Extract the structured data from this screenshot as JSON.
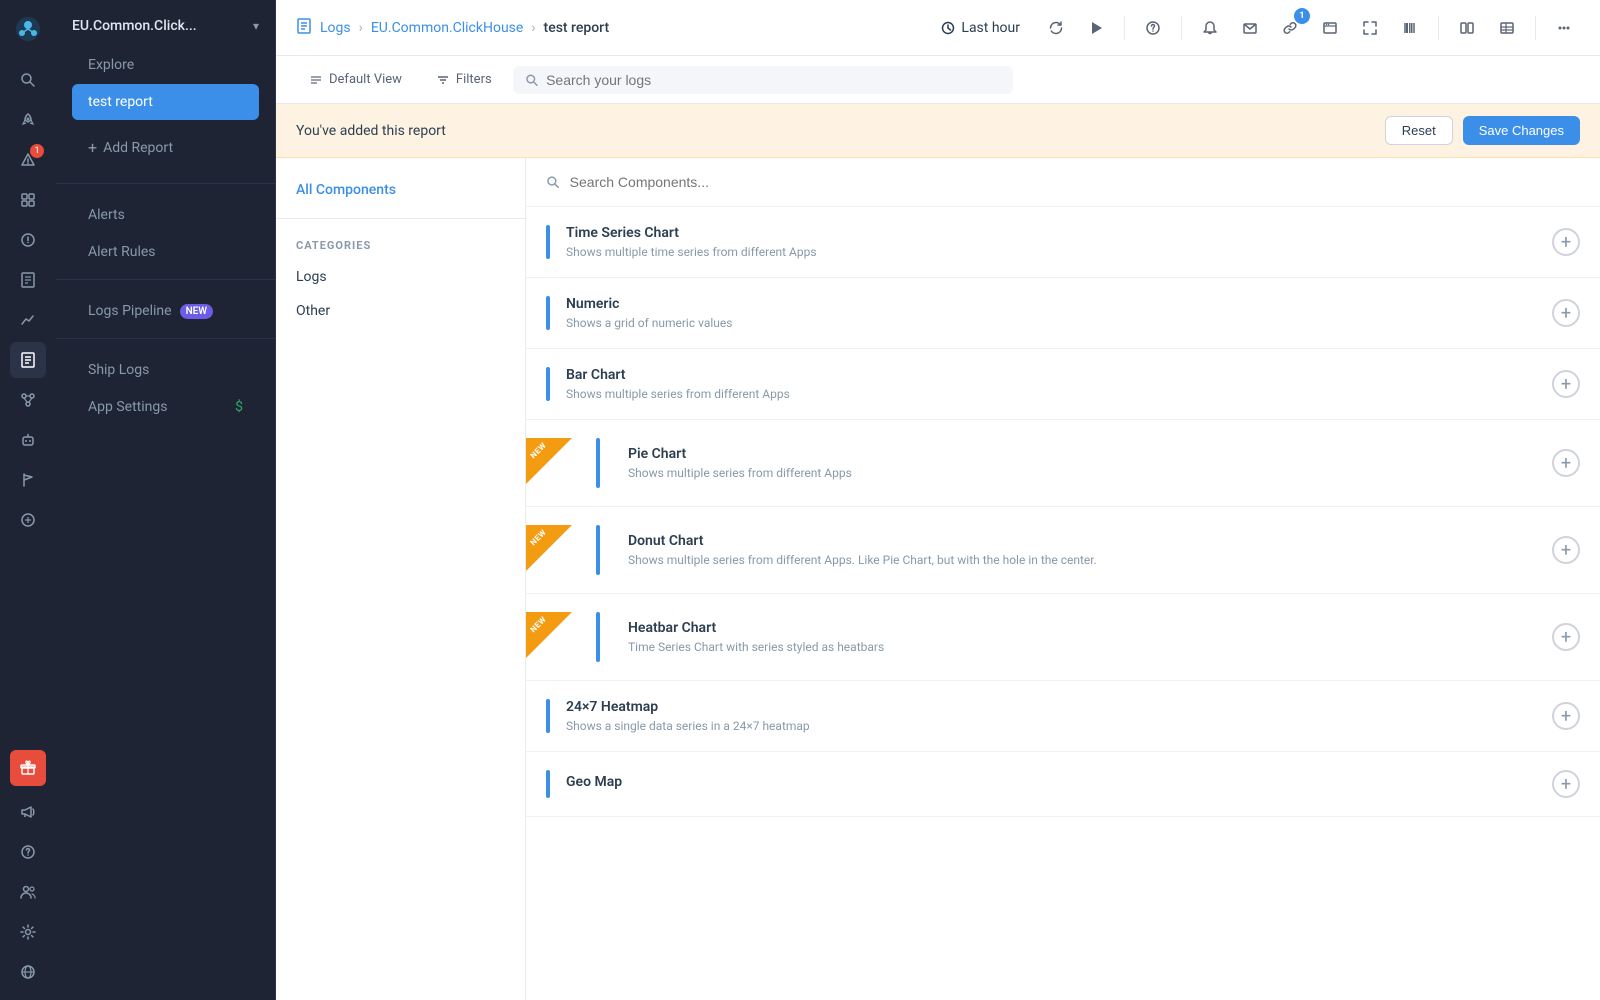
{
  "app": {
    "name": "EU.Common.Click...",
    "chevron": "▾"
  },
  "icon_sidebar": {
    "logo": "🐙",
    "icons": [
      {
        "name": "search-icon",
        "symbol": "🔍",
        "interactable": true
      },
      {
        "name": "rocket-icon",
        "symbol": "🚀",
        "interactable": true,
        "badge": null
      },
      {
        "name": "alert-icon",
        "symbol": "⚠",
        "interactable": true,
        "badge": "1"
      },
      {
        "name": "grid-icon",
        "symbol": "⊞",
        "interactable": true
      },
      {
        "name": "exclamation-icon",
        "symbol": "!",
        "interactable": true
      },
      {
        "name": "table-icon",
        "symbol": "▦",
        "interactable": true
      },
      {
        "name": "chart-icon",
        "symbol": "📊",
        "interactable": true
      },
      {
        "name": "logs-icon",
        "symbol": "📋",
        "interactable": true,
        "active": true
      },
      {
        "name": "integrations-icon",
        "symbol": "⚙",
        "interactable": true
      },
      {
        "name": "robot-icon",
        "symbol": "🤖",
        "interactable": true
      },
      {
        "name": "flag-icon",
        "symbol": "⚑",
        "interactable": true
      },
      {
        "name": "globe-icon",
        "symbol": "🌐",
        "interactable": true
      }
    ],
    "bottom_icons": [
      {
        "name": "gift-icon",
        "symbol": "🎁",
        "interactable": true
      },
      {
        "name": "megaphone-icon",
        "symbol": "📣",
        "interactable": true
      },
      {
        "name": "help-icon",
        "symbol": "?",
        "interactable": true
      },
      {
        "name": "team-icon",
        "symbol": "👥",
        "interactable": true
      },
      {
        "name": "settings-icon",
        "symbol": "⚙",
        "interactable": true
      },
      {
        "name": "language-icon",
        "symbol": "🌐",
        "interactable": true
      }
    ]
  },
  "left_panel": {
    "explore_label": "Explore",
    "active_report": "test report",
    "add_report_label": "+ Add Report",
    "sections": [
      {
        "items": [
          {
            "label": "Alerts",
            "name": "alerts-nav"
          },
          {
            "label": "Alert Rules",
            "name": "alert-rules-nav"
          }
        ]
      },
      {
        "items": [
          {
            "label": "Logs Pipeline",
            "name": "logs-pipeline-nav",
            "badge": "NEW"
          }
        ]
      },
      {
        "items": [
          {
            "label": "Ship Logs",
            "name": "ship-logs-nav"
          },
          {
            "label": "App Settings",
            "name": "app-settings-nav",
            "badge": "$"
          }
        ]
      }
    ]
  },
  "top_bar": {
    "breadcrumb": {
      "icon": "📋",
      "logs_link": "Logs",
      "app_link": "EU.Common.ClickHouse",
      "current": "test report"
    },
    "time_selector": {
      "label": "Last hour",
      "icon": "🕐"
    },
    "actions": [
      {
        "name": "refresh-icon",
        "symbol": "↻"
      },
      {
        "name": "play-icon",
        "symbol": "▶"
      },
      {
        "name": "help-icon",
        "symbol": "?"
      },
      {
        "name": "bell-icon",
        "symbol": "🔔"
      },
      {
        "name": "mail-icon",
        "symbol": "✉"
      },
      {
        "name": "link-icon",
        "symbol": "🔗",
        "badge": "1"
      },
      {
        "name": "screen-icon",
        "symbol": "⊡"
      },
      {
        "name": "fullscreen-icon",
        "symbol": "⛶"
      },
      {
        "name": "barcode-icon",
        "symbol": "▦"
      },
      {
        "name": "split-icon",
        "symbol": "⊟"
      },
      {
        "name": "table2-icon",
        "symbol": "▤"
      },
      {
        "name": "more-icon",
        "symbol": "•••"
      }
    ]
  },
  "toolbar": {
    "default_view_label": "Default View",
    "filters_label": "Filters",
    "search_placeholder": "Search your logs"
  },
  "notification_bar": {
    "text": "You've added this report",
    "reset_label": "Reset",
    "save_label": "Save Changes"
  },
  "component_panel": {
    "all_components_label": "All Components",
    "search_placeholder": "Search Components...",
    "categories_label": "CATEGORIES",
    "categories": [
      {
        "label": "Logs",
        "name": "logs-category"
      },
      {
        "label": "Other",
        "name": "other-category"
      }
    ],
    "components": [
      {
        "name": "time-series-chart",
        "title": "Time Series Chart",
        "description": "Shows multiple time series from different Apps",
        "new": false
      },
      {
        "name": "numeric",
        "title": "Numeric",
        "description": "Shows a grid of numeric values",
        "new": false
      },
      {
        "name": "bar-chart",
        "title": "Bar Chart",
        "description": "Shows multiple series from different Apps",
        "new": false
      },
      {
        "name": "pie-chart",
        "title": "Pie Chart",
        "description": "Shows multiple series from different Apps",
        "new": true
      },
      {
        "name": "donut-chart",
        "title": "Donut Chart",
        "description": "Shows multiple series from different Apps. Like Pie Chart, but with the hole in the center.",
        "new": true
      },
      {
        "name": "heatbar-chart",
        "title": "Heatbar Chart",
        "description": "Time Series Chart with series styled as heatbars",
        "new": true
      },
      {
        "name": "24x7-heatmap",
        "title": "24×7 Heatmap",
        "description": "Shows a single data series in a 24×7 heatmap",
        "new": false
      },
      {
        "name": "geo-map",
        "title": "Geo Map",
        "description": "",
        "new": false
      }
    ]
  }
}
